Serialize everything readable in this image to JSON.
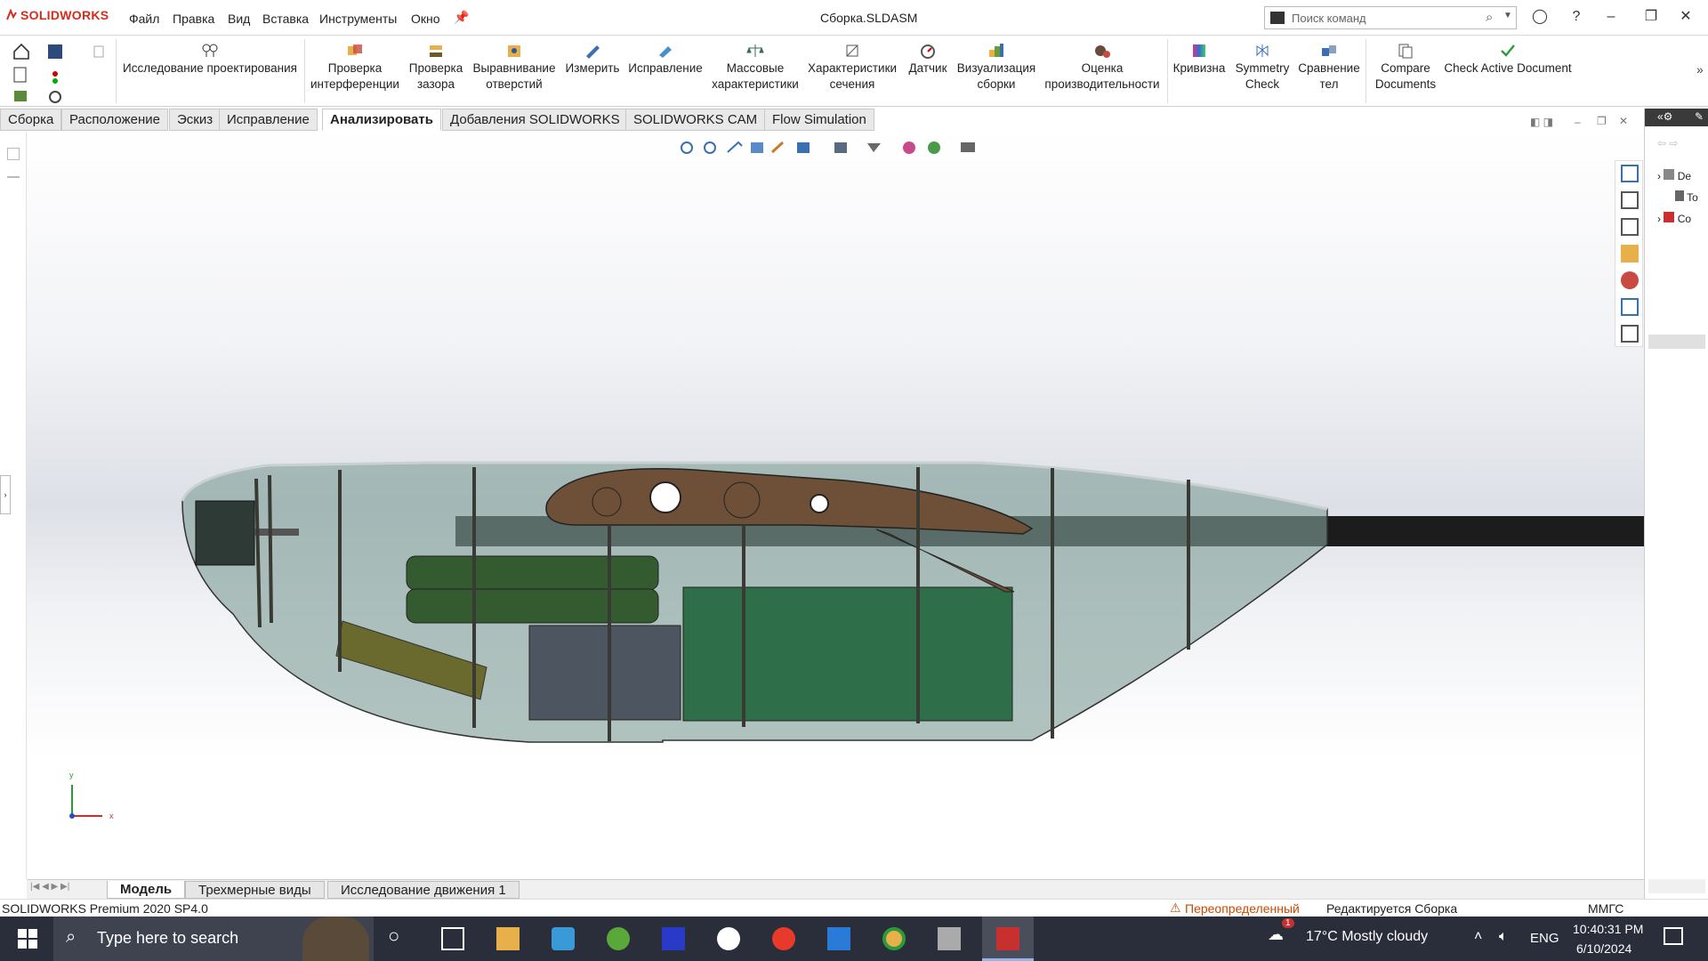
{
  "app": {
    "logo_text": "SOLIDWORKS",
    "document_title": "Сборка.SLDASM"
  },
  "menu": [
    "Файл",
    "Правка",
    "Вид",
    "Вставка",
    "Инструменты",
    "Окно"
  ],
  "search": {
    "placeholder": "Поиск команд"
  },
  "ribbon": {
    "design_study": "Исследование проектирования",
    "buttons": [
      {
        "label": "Проверка интерференции"
      },
      {
        "label": "Проверка зазора"
      },
      {
        "label": "Выравнивание отверстий"
      },
      {
        "label": "Измерить"
      },
      {
        "label": "Исправление"
      },
      {
        "label": "Массовые характеристики"
      },
      {
        "label": "Характеристики сечения"
      },
      {
        "label": "Датчик"
      },
      {
        "label": "Визуализация сборки"
      },
      {
        "label": "Оценка производительности"
      },
      {
        "label": "Кривизна"
      },
      {
        "label": "Symmetry Check"
      },
      {
        "label": "Сравнение тел"
      },
      {
        "label": "Compare Documents"
      },
      {
        "label": "Check Active Document"
      }
    ]
  },
  "tabs": [
    "Сборка",
    "Расположение",
    "Эскиз",
    "Исправление",
    "Анализировать",
    "Добавления SOLIDWORKS",
    "SOLIDWORKS CAM",
    "Flow Simulation"
  ],
  "active_tab": "Анализировать",
  "feature_tree": {
    "items": [
      "De",
      "To",
      "Co"
    ]
  },
  "triad": {
    "x": "x",
    "y": "y"
  },
  "bottom_tabs": [
    "Модель",
    "Трехмерные виды",
    "Исследование движения 1"
  ],
  "status": {
    "version": "SOLIDWORKS Premium 2020 SP4.0",
    "warning": "Переопределенный",
    "editing": "Редактируется Сборка",
    "units": "ММГС"
  },
  "taskbar": {
    "search_placeholder": "Type here to search",
    "weather": "17°C  Mostly cloudy",
    "lang": "ENG",
    "time": "10:40:31 PM",
    "date": "6/10/2024",
    "notification_count": "1"
  },
  "colors": {
    "accent_red": "#d52b1e",
    "taskbar": "#2a2d3a",
    "warning": "#c84a00"
  }
}
